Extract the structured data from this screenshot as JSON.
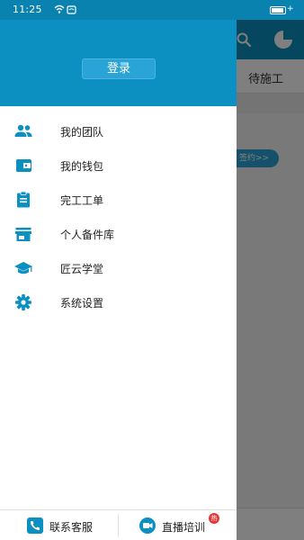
{
  "status_bar": {
    "time": "11:25",
    "icons": [
      "wifi-icon",
      "nfc-icon",
      "battery-icon",
      "charging-icon"
    ],
    "charging_glyph": "+"
  },
  "background_app": {
    "tab_label": "待施工",
    "pill_text": "签约>>",
    "header_icons": [
      "search-icon",
      "pie-chart-icon"
    ]
  },
  "drawer": {
    "login_label": "登录",
    "menu": [
      {
        "icon": "team-icon",
        "label": "我的团队"
      },
      {
        "icon": "wallet-icon",
        "label": "我的钱包"
      },
      {
        "icon": "clipboard-icon",
        "label": "完工工单"
      },
      {
        "icon": "store-icon",
        "label": "个人备件库"
      },
      {
        "icon": "graduation-cap-icon",
        "label": "匠云学堂"
      },
      {
        "icon": "gear-icon",
        "label": "系统设置"
      }
    ],
    "footer": {
      "contact_label": "联系客服",
      "live_label": "直播培训",
      "badge_text": "热"
    }
  },
  "colors": {
    "primary": "#0c8fc1",
    "accent": "#2aa3d6",
    "status_bar": "#0a82b0",
    "badge": "#e53935"
  }
}
